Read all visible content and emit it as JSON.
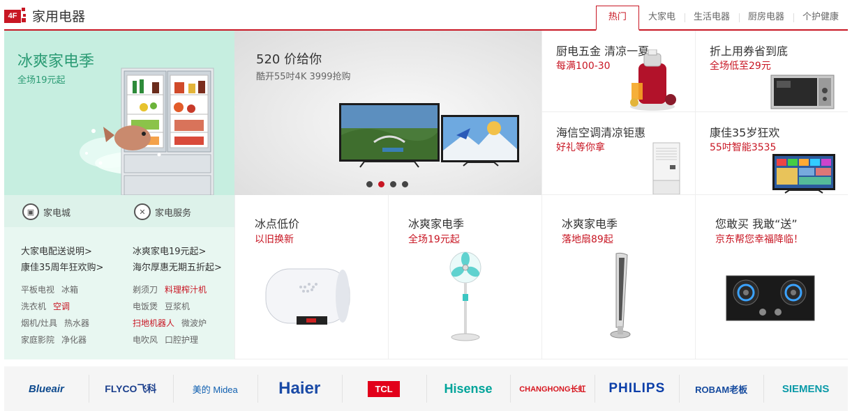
{
  "header": {
    "floor_badge": "4F",
    "title": "家用电器",
    "tabs": [
      "热门",
      "大家电",
      "生活电器",
      "厨房电器",
      "个护健康"
    ],
    "active_tab": "热门"
  },
  "left_promo": {
    "title": "冰爽家电季",
    "subtitle": "全场19元起"
  },
  "services": [
    {
      "icon": "store-icon",
      "label": "家电城"
    },
    {
      "icon": "tools-icon",
      "label": "家电服务"
    }
  ],
  "promo_links": [
    [
      "大家电配送说明>",
      "冰爽家电19元起>"
    ],
    [
      "康佳35周年狂欢购>",
      "海尔厚惠无期五折起>"
    ]
  ],
  "category_links": [
    [
      {
        "t": "平板电视",
        "hl": false
      },
      {
        "t": "冰箱",
        "hl": false
      },
      {
        "t": "剃须刀",
        "hl": false
      },
      {
        "t": "料理榨汁机",
        "hl": true
      }
    ],
    [
      {
        "t": "洗衣机",
        "hl": false
      },
      {
        "t": "空调",
        "hl": true
      },
      {
        "t": "电饭煲",
        "hl": false
      },
      {
        "t": "豆浆机",
        "hl": false
      }
    ],
    [
      {
        "t": "烟机/灶具",
        "hl": false
      },
      {
        "t": "热水器",
        "hl": false
      },
      {
        "t": "扫地机器人",
        "hl": true
      },
      {
        "t": "微波炉",
        "hl": false
      }
    ],
    [
      {
        "t": "家庭影院",
        "hl": false
      },
      {
        "t": "净化器",
        "hl": false
      },
      {
        "t": "电吹风",
        "hl": false
      },
      {
        "t": "口腔护理",
        "hl": false
      }
    ]
  ],
  "slider": {
    "title": "520  价给你",
    "subtitle": "酷开55吋4K 3999抢购",
    "active_index": 1,
    "count": 4
  },
  "small_promos": [
    {
      "title": "厨电五金 清凉一夏",
      "subtitle": "每满100-30",
      "image": "juicer"
    },
    {
      "title": "折上用券省到底",
      "subtitle": "全场低至29元",
      "image": "microwave"
    },
    {
      "title": "海信空调清凉钜惠",
      "subtitle": "好礼等你拿",
      "image": "ac"
    },
    {
      "title": "康佳35岁狂欢",
      "subtitle": "55吋智能3535",
      "image": "tv"
    }
  ],
  "bottom_promos": [
    {
      "title": "冰点低价",
      "subtitle": "以旧换新",
      "image": "water-heater"
    },
    {
      "title": "冰爽家电季",
      "subtitle": "全场19元起",
      "image": "fan"
    },
    {
      "title": "冰爽家电季",
      "subtitle": "落地扇89起",
      "image": "tower-fan"
    },
    {
      "title": "您敢买  我敢“送”",
      "subtitle": "京东帮您幸福降临！",
      "image": "gas-stove"
    }
  ],
  "brands": [
    "Blueair",
    "FLYCO飞科",
    "美的 Midea",
    "Haier",
    "TCL",
    "Hisense",
    "CHANGHONG长虹",
    "PHILIPS",
    "ROBAM老板",
    "SIEMENS"
  ],
  "colors": {
    "accent": "#c81623",
    "mint": "#c6eee0",
    "mint_text": "#2b9b74"
  }
}
